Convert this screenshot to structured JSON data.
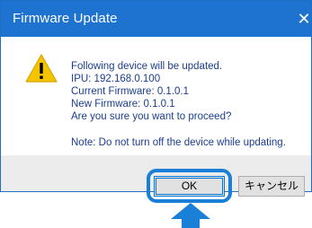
{
  "dialog": {
    "title": "Firmware Update",
    "close_glyph": "✕",
    "icon": "warning-icon",
    "message_lines": [
      "Following device will be updated.",
      "IPU: 192.168.0.100",
      "Current Firmware: 0.1.0.1",
      "New Firmware: 0.1.0.1",
      "Are you sure you want to proceed?"
    ],
    "note": "Note: Do not turn off the device while updating.",
    "buttons": {
      "ok_label": "OK",
      "cancel_label": "キャンセル"
    }
  },
  "annotation": {
    "highlight_color": "#1a7fd6",
    "arrow_color": "#1a7fd6"
  }
}
